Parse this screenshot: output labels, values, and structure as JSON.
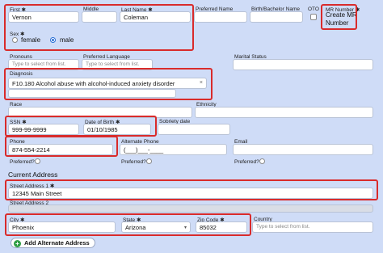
{
  "name": {
    "first_label": "First",
    "first_value": "Vernon",
    "middle_label": "Middle",
    "middle_value": "",
    "last_label": "Last Name",
    "last_value": "Coleman",
    "preferred_label": "Preferred Name",
    "birth_label": "Birth/Bachelor Name",
    "oto_label": "OTO"
  },
  "mr": {
    "label": "MR Number",
    "value_line1": "Create MR",
    "value_line2": "Number"
  },
  "sex": {
    "label": "Sex",
    "options": [
      "female",
      "male"
    ],
    "selected": "male"
  },
  "pronouns": {
    "label": "Pronouns",
    "placeholder": "Type to select from list."
  },
  "preferred_language": {
    "label": "Preferred Language",
    "placeholder": "Type to select from list."
  },
  "marital_status": {
    "label": "Marital Status"
  },
  "diagnosis": {
    "label": "Diagnosis",
    "tag": "F10.180 Alcohol abuse with alcohol-induced anxiety disorder",
    "remove": "×"
  },
  "race": {
    "label": "Race"
  },
  "ethnicity": {
    "label": "Ethnicity"
  },
  "ssn": {
    "label": "SSN",
    "value": "999-99-9999"
  },
  "dob": {
    "label": "Date of Birth",
    "value": "01/10/1985"
  },
  "sobriety": {
    "label": "Sobriety date"
  },
  "phone": {
    "label": "Phone",
    "value": "874-554-2214",
    "preferred_label": "Preferred?"
  },
  "alt_phone": {
    "label": "Alternate Phone",
    "placeholder": "(___)___-____",
    "preferred_label": "Preferred?"
  },
  "email": {
    "label": "Email",
    "preferred_label": "Preferred?"
  },
  "current_address": {
    "heading": "Current Address",
    "street1_label": "Street Address 1",
    "street1_value": "12345 Main Street",
    "street2_label": "Street Address 2",
    "city_label": "City",
    "city_value": "Phoenix",
    "state_label": "State",
    "state_value": "Arizona",
    "zip_label": "Zip Code",
    "zip_value": "85032",
    "country_label": "Country",
    "country_placeholder": "Type to select from list."
  },
  "add_alt_address": {
    "label": "Add Alternate Address",
    "icon": "plus-circle-icon"
  },
  "required_mark": "✱",
  "colors": {
    "background": "#cfdcf7",
    "highlight": "#d92b2b",
    "radio": "#2a6fd6",
    "add_icon": "#2f9e44"
  }
}
